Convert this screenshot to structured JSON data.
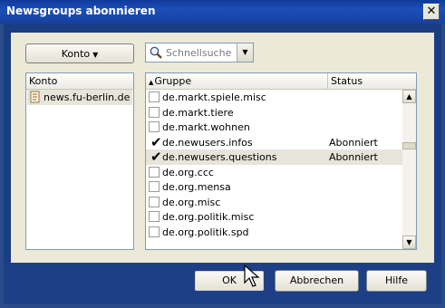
{
  "window": {
    "title": "Newsgroups abonnieren",
    "close_glyph": "✕"
  },
  "toolbar": {
    "account_button_label": "Konto",
    "search_placeholder": "Schnellsuche"
  },
  "accounts": {
    "column_header": "Konto",
    "items": [
      {
        "label": "news.fu-berlin.de",
        "icon": "account-icon"
      }
    ]
  },
  "groups": {
    "columns": {
      "name": "Gruppe",
      "status": "Status"
    },
    "rows": [
      {
        "name": "de.markt.spiele.misc",
        "status": "",
        "checked": false,
        "selected": false
      },
      {
        "name": "de.markt.tiere",
        "status": "",
        "checked": false,
        "selected": false
      },
      {
        "name": "de.markt.wohnen",
        "status": "",
        "checked": false,
        "selected": false
      },
      {
        "name": "de.newusers.infos",
        "status": "Abonniert",
        "checked": true,
        "selected": false
      },
      {
        "name": "de.newusers.questions",
        "status": "Abonniert",
        "checked": true,
        "selected": true
      },
      {
        "name": "de.org.ccc",
        "status": "",
        "checked": false,
        "selected": false
      },
      {
        "name": "de.org.mensa",
        "status": "",
        "checked": false,
        "selected": false
      },
      {
        "name": "de.org.misc",
        "status": "",
        "checked": false,
        "selected": false
      },
      {
        "name": "de.org.politik.misc",
        "status": "",
        "checked": false,
        "selected": false
      },
      {
        "name": "de.org.politik.spd",
        "status": "",
        "checked": false,
        "selected": false
      }
    ]
  },
  "buttons": {
    "ok": "OK",
    "cancel": "Abbrechen",
    "help": "Hilfe"
  }
}
